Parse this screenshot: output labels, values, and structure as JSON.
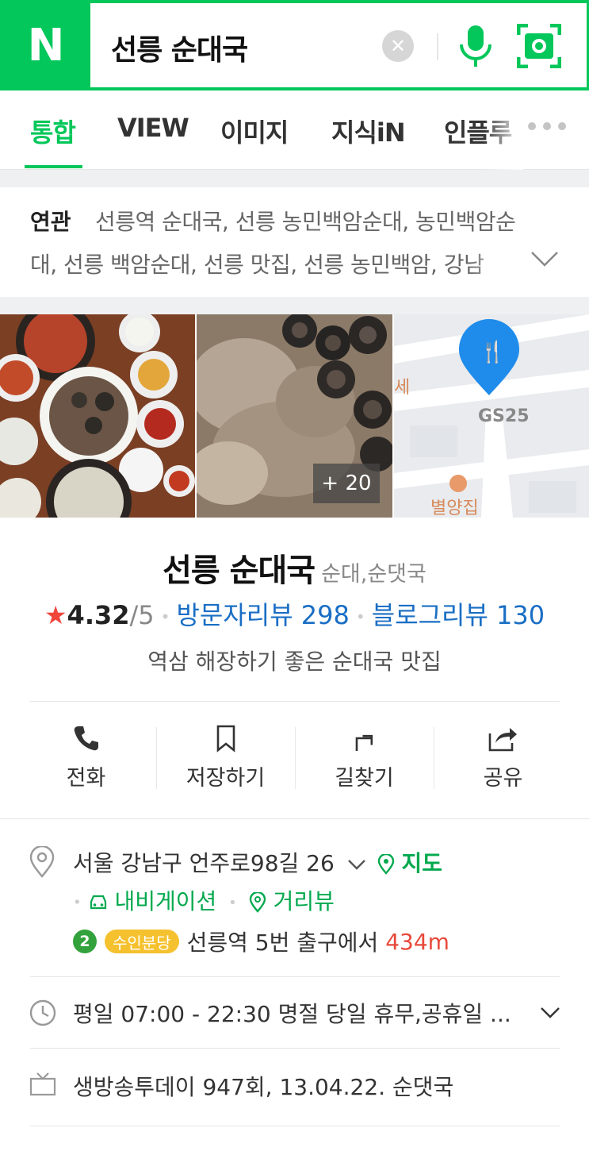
{
  "header": {
    "logo": "N",
    "search_query": "선릉 순대국",
    "clear_icon": "close-icon",
    "mic_icon": "mic-icon",
    "lens_icon": "camera-lens-icon",
    "brand_color": "#03c75a"
  },
  "tabs": [
    {
      "label": "통합",
      "active": true
    },
    {
      "label": "VIEW",
      "active": false
    },
    {
      "label": "이미지",
      "active": false
    },
    {
      "label": "지식iN",
      "active": false
    },
    {
      "label": "인플루",
      "active": false
    }
  ],
  "related": {
    "label": "연관",
    "line1": "선릉역 순대국, 선릉 농민백암순대, 농민백암순",
    "line2": "대, 선릉 백암순대, 선릉 맛집, 선릉 농민백암, 강남"
  },
  "photos": {
    "more_count": "+ 20",
    "map_label_1": "GS25",
    "map_label_2": "별양집",
    "map_label_3": "세"
  },
  "place": {
    "name": "선릉 순대국",
    "category": "순대,순댓국",
    "rating": "4.32",
    "rating_max": "/5",
    "visitor_reviews": "방문자리뷰 298",
    "blog_reviews": "블로그리뷰 130",
    "description": "역삼 해장하기 좋은 순대국 맛집"
  },
  "actions": [
    {
      "label": "전화",
      "icon": "phone-icon"
    },
    {
      "label": "저장하기",
      "icon": "bookmark-icon"
    },
    {
      "label": "길찾기",
      "icon": "directions-icon"
    },
    {
      "label": "공유",
      "icon": "share-icon"
    }
  ],
  "details": {
    "address": "서울 강남구 언주로98길 26",
    "map_link": "지도",
    "navigation_link": "내비게이션",
    "streetview_link": "거리뷰",
    "subway_line": "2",
    "subway_line_name": "수인분당",
    "subway_station": "선릉역 5번 출구에서",
    "subway_distance": "434m",
    "hours": "평일 07:00 - 22:30 명절 당일 휴무,공휴일 ...",
    "tv": "생방송투데이 947회, 13.04.22. 순댓국"
  }
}
